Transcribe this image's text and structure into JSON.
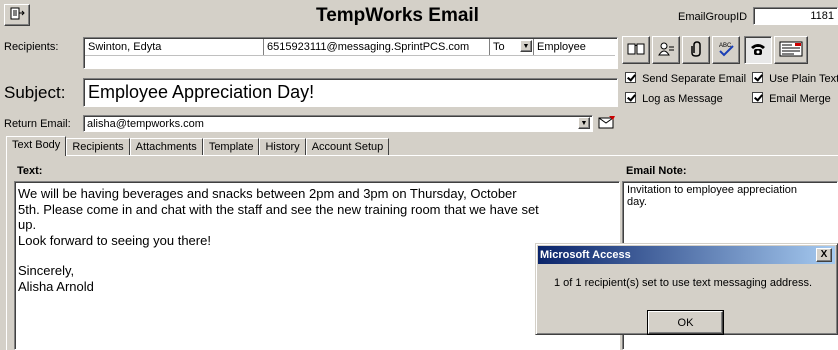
{
  "header": {
    "title": "TempWorks Email",
    "email_group_label": "EmailGroupID",
    "email_group_value": "1181"
  },
  "recipients": {
    "label": "Recipients:",
    "name": "Swinton, Edyta",
    "address": "6515923111@messaging.SprintPCS.com",
    "to_value": "To",
    "type_value": "Employee"
  },
  "subject": {
    "label": "Subject:",
    "value": "Employee Appreciation Day!"
  },
  "return_email": {
    "label": "Return Email:",
    "value": "alisha@tempworks.com"
  },
  "options": {
    "send_separate": "Send Separate Email",
    "use_plain_text": "Use Plain Text",
    "log_as_message": "Log as Message",
    "email_merge": "Email Merge"
  },
  "tabs": [
    "Text Body",
    "Recipients",
    "Attachments",
    "Template",
    "History",
    "Account Setup"
  ],
  "body": {
    "text_label": "Text:",
    "line1": "We will be having beverages and snacks between 2pm and 3pm on Thursday, October",
    "line2": "5th.  Please come in and chat with the staff and see the new training room that we have set",
    "line3": "up.",
    "line4": "Look forward to seeing you there!",
    "line5": "Sincerely,",
    "line6": "Alisha Arnold"
  },
  "note": {
    "label": "Email Note:",
    "value": "Invitation to employee appreciation day."
  },
  "dialog": {
    "title": "Microsoft Access",
    "message": "1 of 1 recipient(s) set to use text messaging address.",
    "ok": "OK",
    "close": "X"
  },
  "icons": [
    "new-message-icon",
    "address-book-icon",
    "contacts-icon",
    "attachment-icon",
    "spell-check-icon",
    "phone-icon",
    "form-icon",
    "return-email-icon"
  ]
}
